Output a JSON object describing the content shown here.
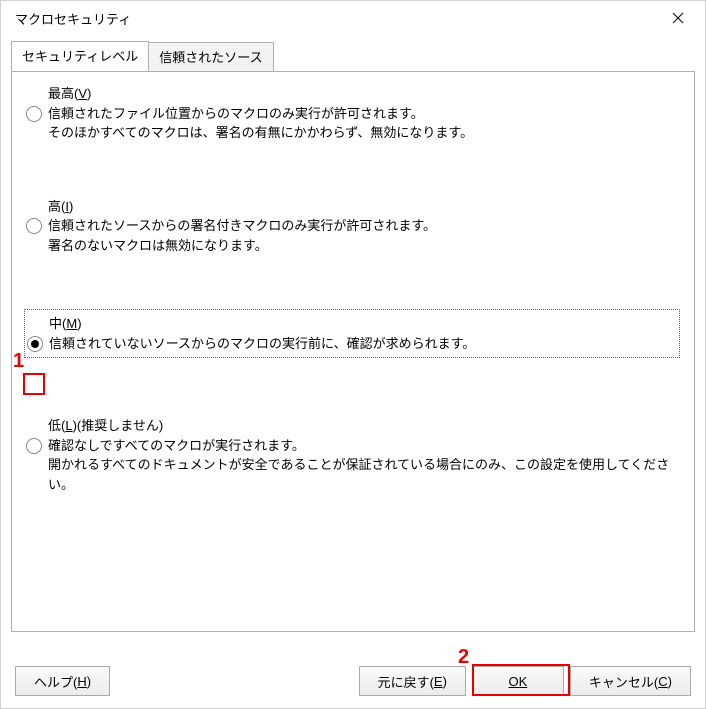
{
  "window": {
    "title": "マクロセキュリティ"
  },
  "tabs": {
    "tab1": "セキュリティレベル",
    "tab2": "信頼されたソース"
  },
  "options": {
    "very_high": {
      "heading_pre": "最高(",
      "heading_key": "V",
      "heading_post": ")",
      "line1": "信頼されたファイル位置からのマクロのみ実行が許可されます。",
      "line2": "そのほかすべてのマクロは、署名の有無にかかわらず、無効になります。"
    },
    "high": {
      "heading_pre": "高(",
      "heading_key": "I",
      "heading_post": ")",
      "line1": "信頼されたソースからの署名付きマクロのみ実行が許可されます。",
      "line2": "署名のないマクロは無効になります。"
    },
    "medium": {
      "heading_pre": "中(",
      "heading_key": "M",
      "heading_post": ")",
      "line1": "信頼されていないソースからのマクロの実行前に、確認が求められます。"
    },
    "low": {
      "heading_pre": "低(",
      "heading_key": "L",
      "heading_post": ")(推奨しません)",
      "line1": "確認なしですべてのマクロが実行されます。",
      "line2": "開かれるすべてのドキュメントが安全であることが保証されている場合にのみ、この設定を使用してください。"
    }
  },
  "buttons": {
    "help_pre": "ヘルプ(",
    "help_key": "H",
    "help_post": ")",
    "reset_pre": "元に戻す(",
    "reset_key": "E",
    "reset_post": ")",
    "ok": "OK",
    "cancel_pre": "キャンセル(",
    "cancel_key": "C",
    "cancel_post": ")"
  },
  "callouts": {
    "c1": "1",
    "c2": "2"
  }
}
